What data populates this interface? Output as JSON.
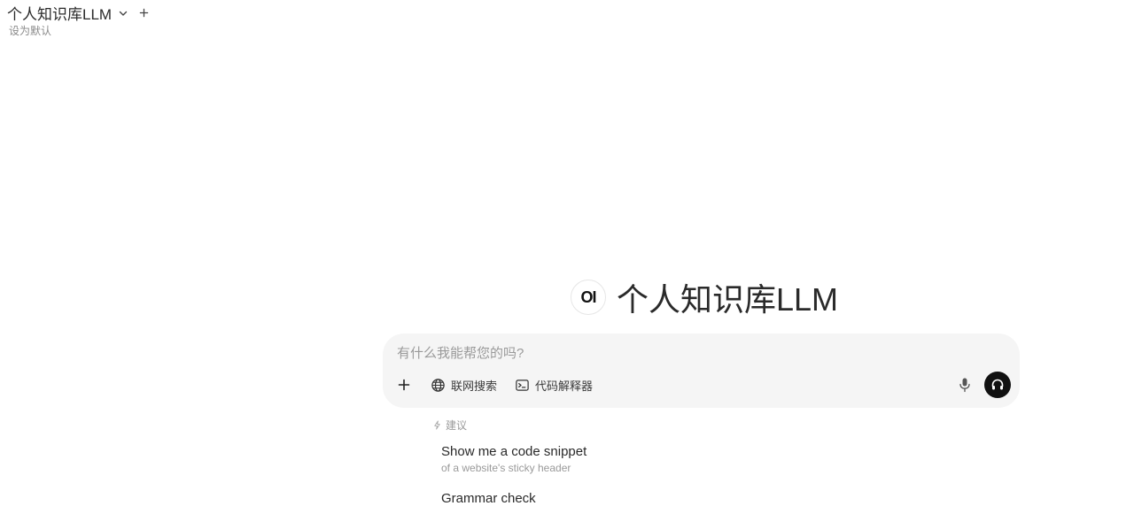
{
  "header": {
    "model_name": "个人知识库LLM",
    "set_default": "设为默认"
  },
  "hero": {
    "logo_text": "OI",
    "title": "个人知识库LLM"
  },
  "composer": {
    "placeholder": "有什么我能帮您的吗?",
    "value": "",
    "tools": {
      "web_search": "联网搜索",
      "code_interpreter": "代码解释器"
    }
  },
  "suggestions": {
    "heading": "建议",
    "items": [
      {
        "title": "Show me a code snippet",
        "subtitle": "of a website's sticky header"
      },
      {
        "title": "Grammar check",
        "subtitle": ""
      }
    ]
  },
  "icons": {
    "chevron": "chevron-down-icon",
    "plus": "plus-icon",
    "globe": "globe-icon",
    "terminal": "terminal-icon",
    "mic": "microphone-icon",
    "headphones": "headphones-icon",
    "sparkle": "sparkle-icon"
  }
}
